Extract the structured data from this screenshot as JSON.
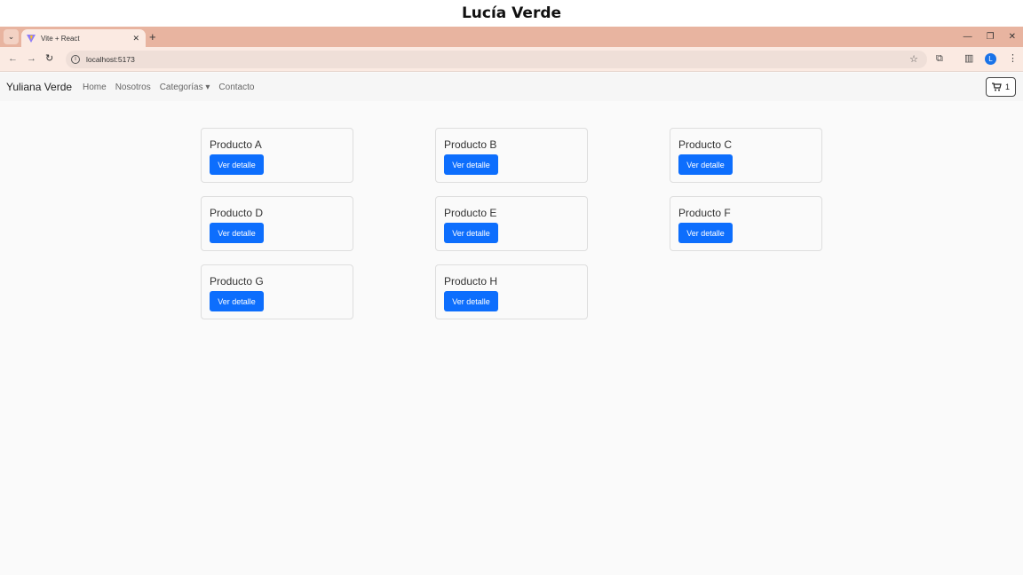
{
  "caption": "Lucía Verde",
  "browser": {
    "tab_title": "Vite + React",
    "url": "localhost:5173",
    "profile_initial": "L"
  },
  "navbar": {
    "brand": "Yuliana Verde",
    "links": [
      "Home",
      "Nosotros",
      "Categorías ▾",
      "Contacto"
    ],
    "cart_count": "1"
  },
  "products": [
    {
      "name": "Producto A",
      "button": "Ver detalle"
    },
    {
      "name": "Producto B",
      "button": "Ver detalle"
    },
    {
      "name": "Producto C",
      "button": "Ver detalle"
    },
    {
      "name": "Producto D",
      "button": "Ver detalle"
    },
    {
      "name": "Producto E",
      "button": "Ver detalle"
    },
    {
      "name": "Producto F",
      "button": "Ver detalle"
    },
    {
      "name": "Producto G",
      "button": "Ver detalle"
    },
    {
      "name": "Producto H",
      "button": "Ver detalle"
    }
  ],
  "colors": {
    "primary": "#0d6efd",
    "tabbar": "#e8b4a0"
  },
  "icons": [
    "tab-list-icon",
    "vite-favicon-icon",
    "close-icon",
    "plus-icon",
    "minimize-icon",
    "restore-icon",
    "window-close-icon",
    "back-icon",
    "forward-icon",
    "reload-icon",
    "site-info-icon",
    "star-icon",
    "extensions-icon",
    "side-panel-icon",
    "menu-icon",
    "cart-icon"
  ]
}
